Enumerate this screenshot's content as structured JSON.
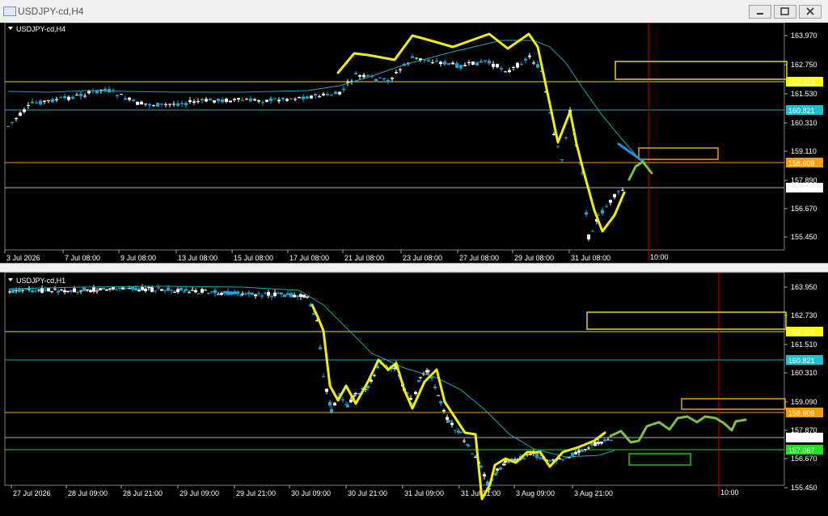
{
  "window": {
    "title": "USDJPY-cd,H4",
    "buttons": [
      "minimize",
      "restore",
      "close"
    ]
  },
  "panels": [
    {
      "id": "h4",
      "symbol_label": "USDJPY-cd,H4",
      "price_ticks": [
        "163.970",
        "162.750",
        "161.530",
        "160.310",
        "159.110",
        "157.890",
        "156.670",
        "155.450"
      ],
      "time_ticks": [
        "3 Jul 2026",
        "7 Jul 08:00",
        "9 Jul 08:00",
        "13 Jul 08:00",
        "15 Jul 08:00",
        "17 Jul 08:00",
        "21 Jul 08:00",
        "23 Jul 08:00",
        "27 Jul 08:00",
        "29 Jul 08:00",
        "31 Jul 08:00"
      ],
      "vline_label": "10:00",
      "levels": [
        {
          "price": "162.023",
          "color": "#e8e000",
          "label_bg": "#ffff00",
          "label_fg": "#000000"
        },
        {
          "price": "160.821",
          "color": "#1aa7b8",
          "label_bg": "#20c0d0",
          "label_fg": "#000000"
        },
        {
          "price": "158.609",
          "color": "#f0a000",
          "label_bg": "#f4a000",
          "label_fg": "#000000"
        },
        {
          "price": "157.546",
          "color": "#b0b0b0",
          "label_bg": "#ffffff",
          "label_fg": "#000000"
        }
      ]
    },
    {
      "id": "h1",
      "symbol_label": "USDJPY-cd,H1",
      "price_ticks": [
        "163.950",
        "162.730",
        "161.510",
        "160.310",
        "159.090",
        "157.870",
        "156.670",
        "155.450"
      ],
      "time_ticks": [
        "27 Jul 2026",
        "28 Jul 09:00",
        "28 Jul 21:00",
        "29 Jul 09:00",
        "29 Jul 21:00",
        "30 Jul 09:00",
        "30 Jul 21:00",
        "31 Jul 09:00",
        "31 Jul 21:00",
        "3 Aug 09:00",
        "3 Aug 21:00"
      ],
      "vline_label": "10:00",
      "levels": [
        {
          "price": "162.023",
          "color": "#e8e000",
          "label_bg": "#ffff00",
          "label_fg": "#000000"
        },
        {
          "price": "160.821",
          "color": "#1aa7b8",
          "label_bg": "#20c0d0",
          "label_fg": "#000000"
        },
        {
          "price": "158.609",
          "color": "#f0a000",
          "label_bg": "#f4a000",
          "label_fg": "#000000"
        },
        {
          "price": "157.546",
          "color": "#b0b0b0",
          "label_bg": "#ffffff",
          "label_fg": "#000000"
        },
        {
          "price": "157.067",
          "color": "#20d020",
          "label_bg": "#20e020",
          "label_fg": "#000000"
        }
      ]
    }
  ],
  "colors": {
    "background": "#000000",
    "candle_up": "#ffffff",
    "candle_down": "#1aa7d8",
    "ma_line": "#1aa7b8",
    "drawing_yellow": "#f0f000",
    "drawing_green": "#80c040",
    "drawing_blue": "#2090e0",
    "vline": "#c00000"
  }
}
